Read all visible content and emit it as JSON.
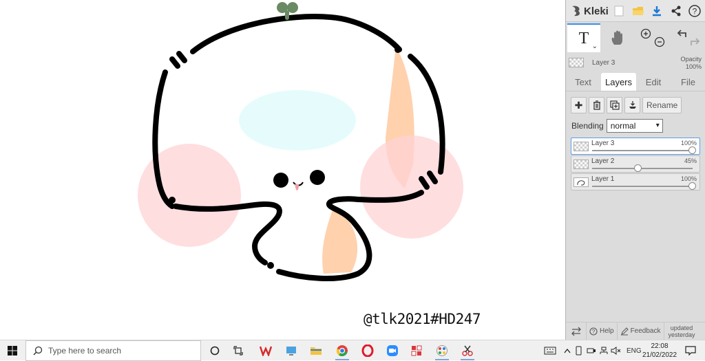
{
  "canvas": {
    "watermark": "@tlk2021#HD247"
  },
  "app": {
    "name": "Kleki"
  },
  "tools": {
    "text_glyph": "T",
    "text_chevron": "⌄"
  },
  "current_layer": {
    "name": "Layer 3",
    "opacity_label": "Opacity",
    "opacity_value": "100%"
  },
  "tabs": [
    {
      "label": "Text"
    },
    {
      "label": "Layers"
    },
    {
      "label": "Edit"
    },
    {
      "label": "File"
    }
  ],
  "layers_panel": {
    "rename_label": "Rename",
    "blending_label": "Blending",
    "blending_value": "normal",
    "layers": [
      {
        "name": "Layer 3",
        "opacity": "100%",
        "opacity_fraction": 1.0
      },
      {
        "name": "Layer 2",
        "opacity": "45%",
        "opacity_fraction": 0.45
      },
      {
        "name": "Layer 1",
        "opacity": "100%",
        "opacity_fraction": 1.0
      }
    ]
  },
  "footer": {
    "help": "Help",
    "feedback": "Feedback",
    "updated_line1": "updated",
    "updated_line2": "yesterday"
  },
  "taskbar": {
    "search_placeholder": "Type here to search",
    "language": "ENG",
    "time": "22:08",
    "date": "21/02/2022"
  },
  "colors": {
    "accent": "#3c8ee8",
    "blush": "#ffdfe0",
    "peach": "#ffd1ad",
    "cyan": "#e6fcfc",
    "sprout": "#6a8a63"
  }
}
